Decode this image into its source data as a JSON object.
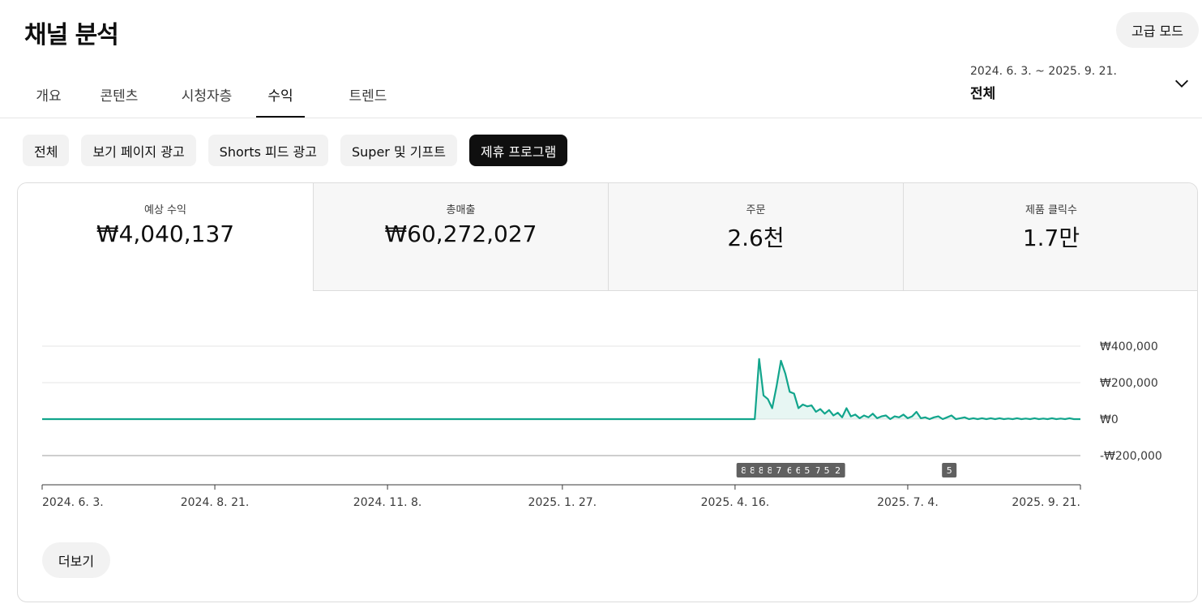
{
  "header": {
    "title": "채널 분석",
    "advanced_mode_label": "고급 모드"
  },
  "tabs": [
    {
      "label": "개요"
    },
    {
      "label": "콘텐츠"
    },
    {
      "label": "시청자층"
    },
    {
      "label": "수익",
      "active": true
    },
    {
      "label": "트렌드"
    }
  ],
  "date_range": {
    "range": "2024. 6. 3. ~ 2025. 9. 21.",
    "preset": "전체",
    "icon": "chevron-down-icon"
  },
  "filter_chips": [
    {
      "label": "전체"
    },
    {
      "label": "보기 페이지 광고"
    },
    {
      "label": "Shorts 피드 광고"
    },
    {
      "label": "Super 및 기프트"
    },
    {
      "label": "제휴 프로그램",
      "active": true
    }
  ],
  "metrics": [
    {
      "label": "예상 수익",
      "value": "₩4,040,137",
      "active": true
    },
    {
      "label": "총매출",
      "value": "₩60,272,027"
    },
    {
      "label": "주문",
      "value": "2.6천"
    },
    {
      "label": "제품 클릭수",
      "value": "1.7만"
    }
  ],
  "more_label": "더보기",
  "colors": {
    "accent": "#12a58c",
    "marker_bg": "#606060",
    "active_chip": "#0f0f0f"
  },
  "chart_data": {
    "type": "line",
    "series": [
      {
        "points": [
          [
            "2024-06-03",
            0
          ],
          [
            "2025-04-25",
            0
          ],
          [
            "2025-04-27",
            330000
          ],
          [
            "2025-04-29",
            130000
          ],
          [
            "2025-05-01",
            110000
          ],
          [
            "2025-05-03",
            60000
          ],
          [
            "2025-05-05",
            180000
          ],
          [
            "2025-05-07",
            320000
          ],
          [
            "2025-05-09",
            250000
          ],
          [
            "2025-05-11",
            150000
          ],
          [
            "2025-05-13",
            140000
          ],
          [
            "2025-05-15",
            60000
          ],
          [
            "2025-05-17",
            80000
          ],
          [
            "2025-05-19",
            70000
          ],
          [
            "2025-05-21",
            75000
          ],
          [
            "2025-05-23",
            40000
          ],
          [
            "2025-05-25",
            55000
          ],
          [
            "2025-05-27",
            30000
          ],
          [
            "2025-05-29",
            50000
          ],
          [
            "2025-05-31",
            20000
          ],
          [
            "2025-06-02",
            35000
          ],
          [
            "2025-06-04",
            10000
          ],
          [
            "2025-06-06",
            60000
          ],
          [
            "2025-06-08",
            15000
          ],
          [
            "2025-06-10",
            25000
          ],
          [
            "2025-06-12",
            5000
          ],
          [
            "2025-06-14",
            20000
          ],
          [
            "2025-06-16",
            10000
          ],
          [
            "2025-06-18",
            30000
          ],
          [
            "2025-06-20",
            5000
          ],
          [
            "2025-06-22",
            15000
          ],
          [
            "2025-06-24",
            20000
          ],
          [
            "2025-06-26",
            0
          ],
          [
            "2025-06-28",
            15000
          ],
          [
            "2025-06-30",
            10000
          ],
          [
            "2025-07-02",
            25000
          ],
          [
            "2025-07-04",
            5000
          ],
          [
            "2025-07-06",
            15000
          ],
          [
            "2025-07-08",
            40000
          ],
          [
            "2025-07-10",
            5000
          ],
          [
            "2025-07-12",
            10000
          ],
          [
            "2025-07-14",
            0
          ],
          [
            "2025-07-16",
            10000
          ],
          [
            "2025-07-18",
            15000
          ],
          [
            "2025-07-20",
            0
          ],
          [
            "2025-07-22",
            10000
          ],
          [
            "2025-07-24",
            20000
          ],
          [
            "2025-07-26",
            0
          ],
          [
            "2025-07-28",
            5000
          ],
          [
            "2025-07-30",
            10000
          ],
          [
            "2025-08-01",
            0
          ],
          [
            "2025-08-03",
            5000
          ],
          [
            "2025-08-05",
            0
          ],
          [
            "2025-08-07",
            5000
          ],
          [
            "2025-08-09",
            0
          ],
          [
            "2025-08-11",
            5000
          ],
          [
            "2025-08-13",
            0
          ],
          [
            "2025-08-15",
            5000
          ],
          [
            "2025-08-17",
            0
          ],
          [
            "2025-08-19",
            3000
          ],
          [
            "2025-08-21",
            0
          ],
          [
            "2025-08-23",
            5000
          ],
          [
            "2025-08-25",
            0
          ],
          [
            "2025-08-27",
            3000
          ],
          [
            "2025-08-29",
            0
          ],
          [
            "2025-08-31",
            5000
          ],
          [
            "2025-09-02",
            0
          ],
          [
            "2025-09-04",
            3000
          ],
          [
            "2025-09-06",
            0
          ],
          [
            "2025-09-08",
            5000
          ],
          [
            "2025-09-10",
            0
          ],
          [
            "2025-09-12",
            3000
          ],
          [
            "2025-09-14",
            0
          ],
          [
            "2025-09-16",
            5000
          ],
          [
            "2025-09-18",
            0
          ],
          [
            "2025-09-21",
            0
          ]
        ]
      }
    ],
    "x_range": [
      "2024-06-03",
      "2025-09-21"
    ],
    "ylim": [
      -200000,
      400000
    ],
    "y_ticks": [
      400000,
      200000,
      0,
      -200000
    ],
    "y_tick_labels": [
      "₩400,000",
      "₩200,000",
      "₩0",
      "-₩200,000"
    ],
    "x_ticks": [
      "2024-06-03",
      "2024-08-21",
      "2024-11-08",
      "2025-01-27",
      "2025-04-16",
      "2025-07-04",
      "2025-09-21"
    ],
    "x_tick_labels": [
      "2024. 6. 3.",
      "2024. 8. 21.",
      "2024. 11. 8.",
      "2025. 1. 27.",
      "2025. 4. 16.",
      "2025. 7. 4.",
      "2025. 9. 21."
    ],
    "upload_markers": [
      {
        "date": "2025-04-20",
        "label": "8"
      },
      {
        "date": "2025-04-24",
        "label": "8"
      },
      {
        "date": "2025-04-28",
        "label": "8"
      },
      {
        "date": "2025-05-02",
        "label": "8"
      },
      {
        "date": "2025-05-06",
        "label": "7"
      },
      {
        "date": "2025-05-11",
        "label": "6"
      },
      {
        "date": "2025-05-15",
        "label": "6"
      },
      {
        "date": "2025-05-19",
        "label": "5"
      },
      {
        "date": "2025-05-24",
        "label": "7"
      },
      {
        "date": "2025-05-28",
        "label": "5"
      },
      {
        "date": "2025-06-02",
        "label": "2"
      },
      {
        "date": "2025-07-23",
        "label": "5"
      }
    ]
  }
}
